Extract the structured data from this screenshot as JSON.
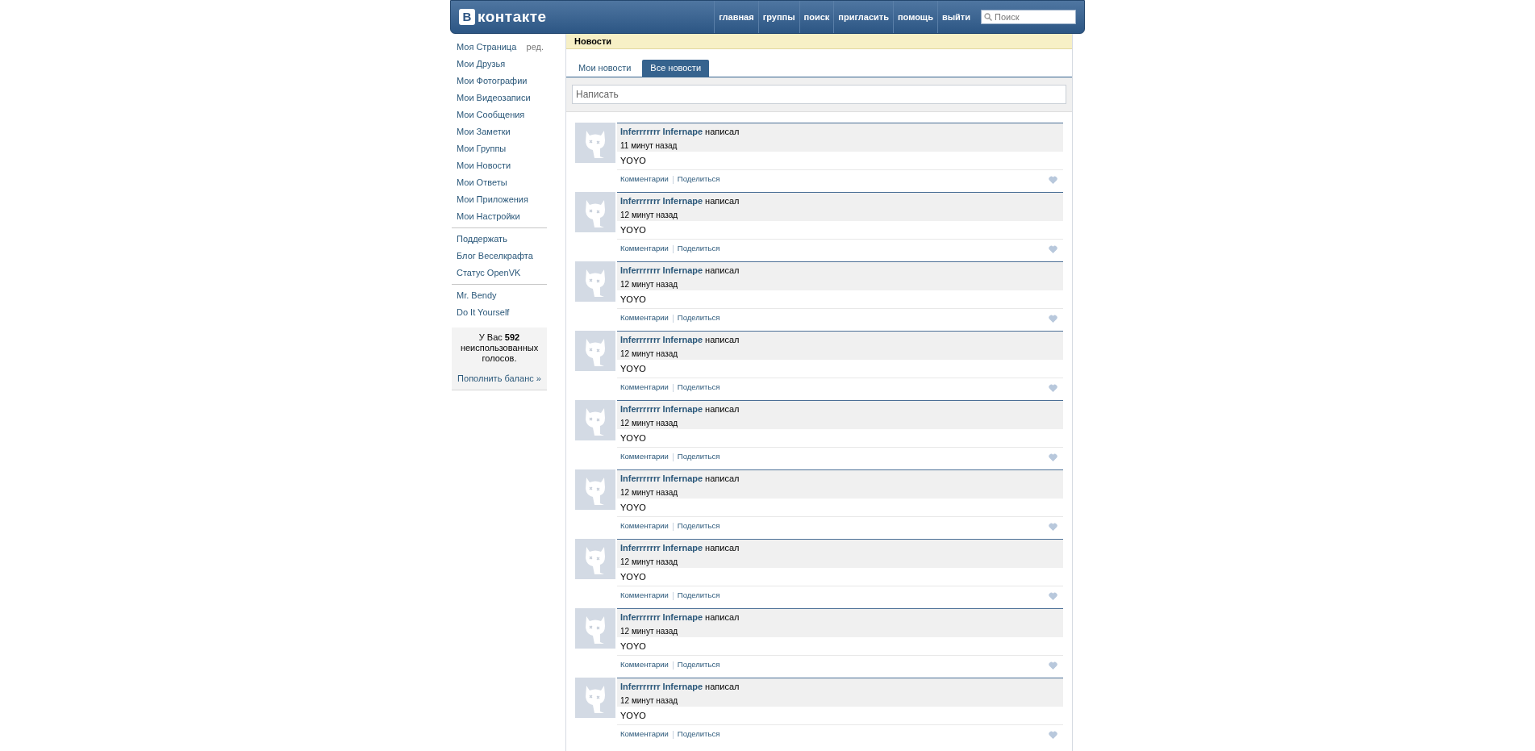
{
  "header": {
    "logo_letter": "B",
    "logo_text": "контакте",
    "nav": [
      "главная",
      "группы",
      "поиск",
      "пригласить",
      "помощь",
      "выйти"
    ],
    "search": {
      "placeholder": "Поиск"
    }
  },
  "sidebar": {
    "groups": [
      [
        {
          "label": "Моя Страница",
          "extra": "ред."
        },
        {
          "label": "Мои Друзья"
        },
        {
          "label": "Мои Фотографии"
        },
        {
          "label": "Мои Видеозаписи"
        },
        {
          "label": "Мои Сообщения"
        },
        {
          "label": "Мои Заметки"
        },
        {
          "label": "Мои Группы"
        },
        {
          "label": "Мои Новости"
        },
        {
          "label": "Мои Ответы"
        },
        {
          "label": "Мои Приложения"
        },
        {
          "label": "Мои Настройки"
        }
      ],
      [
        {
          "label": "Поддержать"
        },
        {
          "label": "Блог Веселкрафта"
        },
        {
          "label": "Статус OpenVK"
        }
      ],
      [
        {
          "label": "Mr. Bendy"
        },
        {
          "label": "Do It Yourself"
        }
      ]
    ],
    "votes": {
      "text": "У Вас **592** неиспользованных голосов.",
      "link": "Пополнить баланс »"
    }
  },
  "news": {
    "title": "Новости",
    "tabs": [
      {
        "label": "Мои новости",
        "selected": false
      },
      {
        "label": "Все новости",
        "selected": true
      }
    ],
    "composer": {
      "placeholder": "Написать"
    },
    "posts": [
      {
        "author": "Inferrrrrrr Infernape",
        "action": "написал",
        "time": "11 минут назад",
        "text": "YOYO",
        "links": [
          "Комментарии",
          "Поделиться"
        ]
      },
      {
        "author": "Inferrrrrrr Infernape",
        "action": "написал",
        "time": "12 минут назад",
        "text": "YOYO",
        "links": [
          "Комментарии",
          "Поделиться"
        ]
      },
      {
        "author": "Inferrrrrrr Infernape",
        "action": "написал",
        "time": "12 минут назад",
        "text": "YOYO",
        "links": [
          "Комментарии",
          "Поделиться"
        ]
      },
      {
        "author": "Inferrrrrrr Infernape",
        "action": "написал",
        "time": "12 минут назад",
        "text": "YOYO",
        "links": [
          "Комментарии",
          "Поделиться"
        ]
      },
      {
        "author": "Inferrrrrrr Infernape",
        "action": "написал",
        "time": "12 минут назад",
        "text": "YOYO",
        "links": [
          "Комментарии",
          "Поделиться"
        ]
      },
      {
        "author": "Inferrrrrrr Infernape",
        "action": "написал",
        "time": "12 минут назад",
        "text": "YOYO",
        "links": [
          "Комментарии",
          "Поделиться"
        ]
      },
      {
        "author": "Inferrrrrrr Infernape",
        "action": "написал",
        "time": "12 минут назад",
        "text": "YOYO",
        "links": [
          "Комментарии",
          "Поделиться"
        ]
      },
      {
        "author": "Inferrrrrrr Infernape",
        "action": "написал",
        "time": "12 минут назад",
        "text": "YOYO",
        "links": [
          "Комментарии",
          "Поделиться"
        ]
      },
      {
        "author": "Inferrrrrrr Infernape",
        "action": "написал",
        "time": "12 минут назад",
        "text": "YOYO",
        "links": [
          "Комментарии",
          "Поделиться"
        ]
      }
    ]
  }
}
